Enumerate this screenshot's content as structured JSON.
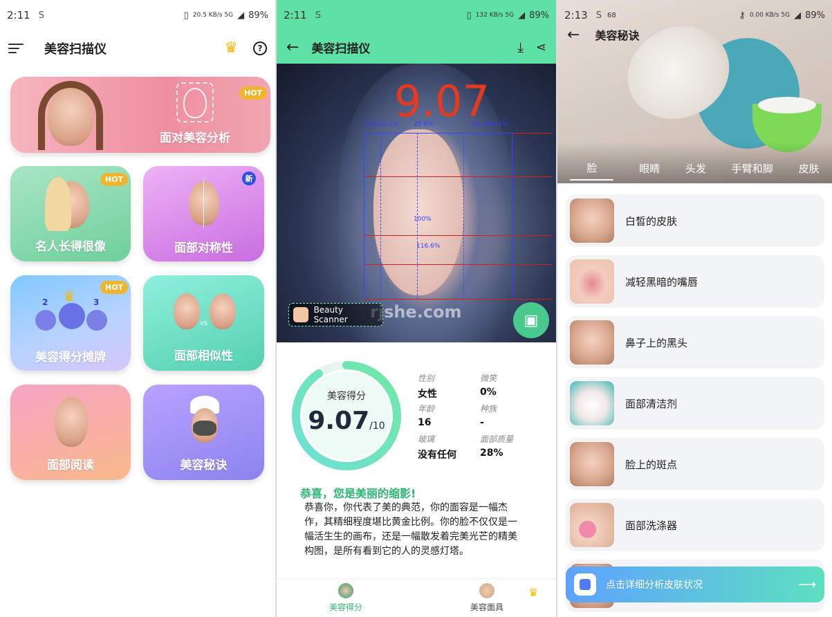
{
  "panel1": {
    "status": {
      "time": "2:11",
      "sym": "S",
      "net": "20.5 KB/s 5G",
      "battery": "89%"
    },
    "title": "美容扫描仪",
    "cards": {
      "face_analysis": "面对美容分析",
      "celebrity": "名人长得很像",
      "symmetry": "面部对称性",
      "ranking": "美容得分摊牌",
      "similarity": "面部相似性",
      "reading": "面部阅读",
      "tips": "美容秘诀"
    },
    "badges": {
      "hot": "HOT",
      "new": "新",
      "rank2": "2",
      "rank3": "3",
      "vs": "vs"
    }
  },
  "panel2": {
    "status": {
      "time": "2:11",
      "sym": "S",
      "net": "132 KB/s 5G",
      "battery": "89%"
    },
    "title": "美容扫描仪",
    "big_score": "9.07",
    "percentages": [
      "5.8%",
      "20.1%",
      "25.8%",
      "26.2%",
      "22.1%"
    ],
    "ratio_a": "100%",
    "ratio_b": "116.6%",
    "tag": "Beauty Scanner",
    "watermark": "rjshe.com",
    "score_label": "美容得分",
    "score_value": "9.07",
    "score_max": "/10",
    "score_fraction": 0.907,
    "attrs": {
      "gender_k": "性别",
      "gender_v": "女性",
      "smile_k": "微笑",
      "smile_v": "0%",
      "age_k": "年龄",
      "age_v": "16",
      "race_k": "种族",
      "race_v": "-",
      "glass_k": "玻璃",
      "glass_v": "没有任何",
      "quality_k": "面部质量",
      "quality_v": "28%"
    },
    "congrats": "恭喜，您是美丽的缩影!",
    "description": "恭喜你，你代表了美的典范，你的面容是一幅杰作，其精细程度堪比黄金比例。你的脸不仅仅是一幅活生生的画布，还是一幅散发着完美光芒的精美构图，是所有看到它的人的灵感灯塔。",
    "tabs": {
      "score": "美容得分",
      "mask": "美容面具"
    }
  },
  "panel3": {
    "status": {
      "time": "2:13",
      "sym": "S",
      "notif": "68",
      "net": "0.00 KB/s 5G",
      "battery": "89%"
    },
    "title": "美容秘诀",
    "categories": [
      "脸",
      "眼睛",
      "头发",
      "手臂和脚",
      "皮肤"
    ],
    "items": [
      "白皙的皮肤",
      "减轻黑暗的嘴唇",
      "鼻子上的黑头",
      "面部清洁剂",
      "脸上的斑点",
      "面部洗涤器"
    ],
    "cta": "点击详细分析皮肤状况"
  }
}
